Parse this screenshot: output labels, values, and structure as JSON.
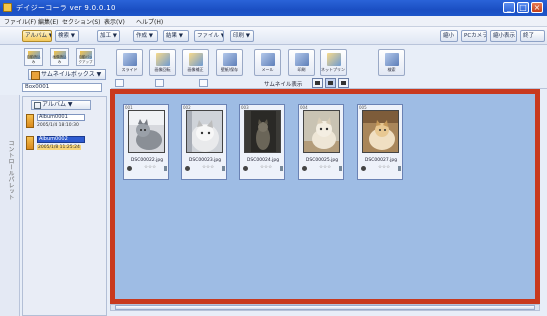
{
  "window": {
    "title": "デイジーコーラ ver 9.0.0.10",
    "minimize": "_",
    "maximize": "□",
    "close": "×",
    "colors": {
      "titlebar": "#1b4fc3",
      "content_bg": "#9ebce4",
      "highlight_border": "#c8391e"
    }
  },
  "menu": [
    "ファイル(F)",
    "編集(E)",
    "セクション(S)",
    "表示(V)",
    "ヘルプ(H)"
  ],
  "toolbar": {
    "left": [
      "アルバム ▼",
      "検索 ▼",
      "加工 ▼",
      "作成 ▼",
      "結果 ▼",
      "ファイル ▼",
      "印刷 ▼"
    ],
    "right": [
      "縮小",
      "PCカメラ",
      "縮小表示",
      "終了"
    ]
  },
  "left_icons": [
    {
      "label": "自動読込み",
      "icon": "auto-import-icon"
    },
    {
      "label": "画像読込み",
      "icon": "import-icon"
    },
    {
      "label": "自動バックアップ",
      "icon": "backup-icon"
    }
  ],
  "mode_select": "サムネイルボックス ▼",
  "user_field": "Box0001",
  "side_tab_label": "コントロールパレット",
  "album_panel": {
    "header": "アルバム ▼",
    "albums": [
      {
        "name": "Album0001",
        "date": "2005/1/4 18:10:30",
        "selected": false
      },
      {
        "name": "Album0002",
        "date": "2005/1/8 11:25:24",
        "selected": true
      }
    ]
  },
  "big_buttons": [
    {
      "label": "スライド",
      "icon": "slideshow-icon"
    },
    {
      "label": "画像回転",
      "icon": "rotate-icon"
    },
    {
      "label": "画像補正",
      "icon": "correct-icon"
    },
    {
      "label": "壁紙/保存",
      "icon": "wallpaper-icon"
    },
    {
      "label": "メール",
      "icon": "mail-icon"
    },
    {
      "label": "印刷",
      "icon": "print-icon"
    },
    {
      "label": "ネットプリント",
      "icon": "net-print-icon"
    },
    {
      "label": "検索",
      "icon": "search-icon"
    }
  ],
  "thumb_bar": {
    "label": "サムネイル表示",
    "sizes": [
      "small",
      "medium",
      "large"
    ]
  },
  "thumbnails": [
    {
      "num": "001",
      "file": "DSC00022.jpg",
      "stars": "☆☆☆"
    },
    {
      "num": "002",
      "file": "DSC00023.jpg",
      "stars": "☆☆☆"
    },
    {
      "num": "003",
      "file": "DSC00024.jpg",
      "stars": "☆☆☆"
    },
    {
      "num": "004",
      "file": "DSC00025.jpg",
      "stars": "☆☆☆"
    },
    {
      "num": "005",
      "file": "DSC00027.jpg",
      "stars": "☆☆☆"
    }
  ]
}
